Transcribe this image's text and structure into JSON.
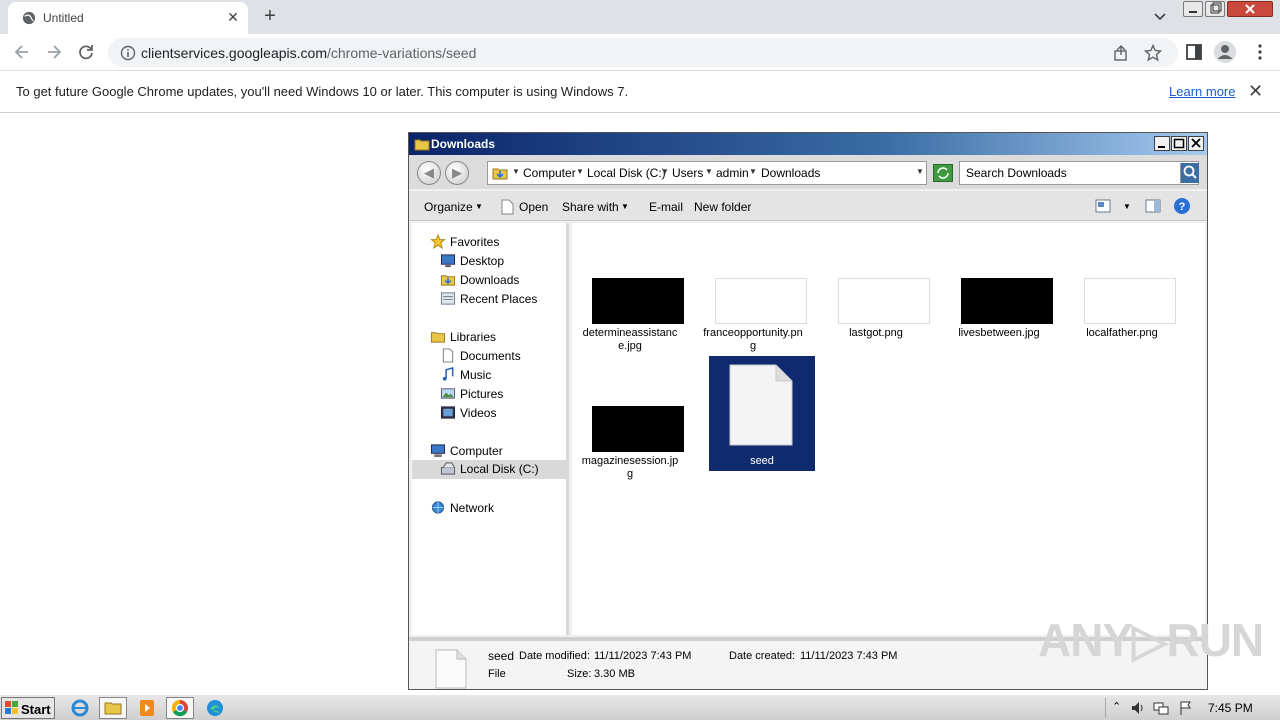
{
  "browser": {
    "tab_title": "Untitled",
    "tab_close_glyph": "✕",
    "new_tab_glyph": "+",
    "url_host": "clientservices.googleapis.com",
    "url_path": "/chrome-variations/seed",
    "accent": "#1a5cc8"
  },
  "infobar": {
    "message": "To get future Google Chrome updates, you'll need Windows 10 or later. This computer is using Windows 7.",
    "learn_more": "Learn more",
    "close_glyph": "✕"
  },
  "explorer": {
    "title": "Downloads",
    "breadcrumbs": [
      "Computer",
      "Local Disk (C:)",
      "Users",
      "admin",
      "Downloads"
    ],
    "search_placeholder": "Search Downloads",
    "commands": {
      "organize": "Organize",
      "open": "Open",
      "share_with": "Share with",
      "email": "E-mail",
      "new_folder": "New folder"
    },
    "nav": {
      "favorites": "Favorites",
      "desktop": "Desktop",
      "downloads": "Downloads",
      "recent_places": "Recent Places",
      "libraries": "Libraries",
      "documents": "Documents",
      "music": "Music",
      "pictures": "Pictures",
      "videos": "Videos",
      "computer": "Computer",
      "local_disk": "Local Disk (C:)",
      "network": "Network"
    },
    "files": [
      {
        "name": "determineassistance.jpg",
        "thumb": "dark"
      },
      {
        "name": "franceopportunity.png",
        "thumb": "light"
      },
      {
        "name": "lastgot.png",
        "thumb": "light"
      },
      {
        "name": "livesbetween.jpg",
        "thumb": "dark"
      },
      {
        "name": "localfather.png",
        "thumb": "light"
      },
      {
        "name": "magazinesession.jpg",
        "thumb": "dark"
      },
      {
        "name": "seed",
        "thumb": "document",
        "selected": true
      }
    ],
    "status": {
      "name": "seed",
      "type": "File",
      "modified_label": "Date modified:",
      "modified_value": "11/11/2023 7:43 PM",
      "created_label": "Date created:",
      "created_value": "11/11/2023 7:43 PM",
      "size_label": "Size:",
      "size_value": "3.30 MB"
    },
    "selection_color": "#0f2a6f"
  },
  "watermark": "ANY▷RUN",
  "taskbar": {
    "start_label": "Start",
    "clock": "7:45 PM",
    "items": [
      "ie-icon",
      "explorer-icon",
      "media-player-icon",
      "chrome-icon",
      "edge-icon"
    ]
  }
}
